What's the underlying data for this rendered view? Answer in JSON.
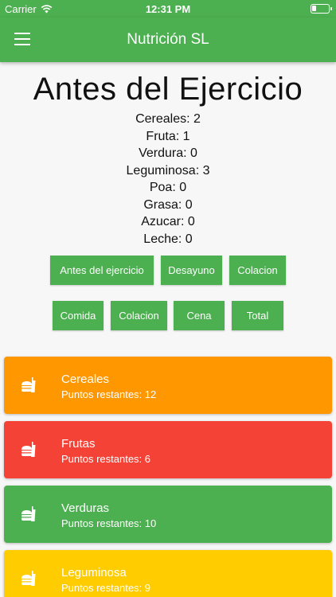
{
  "status_bar": {
    "carrier": "Carrier",
    "time": "12:31 PM"
  },
  "app_bar": {
    "title": "Nutrición SL"
  },
  "summary": {
    "title": "Antes del Ejercicio",
    "items": [
      "Cereales: 2",
      "Fruta: 1",
      "Verdura: 0",
      "Leguminosa: 3",
      "Poa: 0",
      "Grasa: 0",
      "Azucar: 0",
      "Leche: 0"
    ]
  },
  "meal_buttons": [
    "Antes del ejercicio",
    "Desayuno",
    "Colacion",
    "Comida",
    "Colacion",
    "Cena",
    "Total"
  ],
  "categories": [
    {
      "name": "Cereales",
      "points": "Puntos restantes: 12",
      "color": "#ff9800",
      "icon": "food-icon"
    },
    {
      "name": "Frutas",
      "points": "Puntos restantes: 6",
      "color": "#f44336",
      "icon": "food-icon"
    },
    {
      "name": "Verduras",
      "points": "Puntos restantes: 10",
      "color": "#4caf50",
      "icon": "food-icon"
    },
    {
      "name": "Leguminosa",
      "points": "Puntos restantes: 9",
      "color": "#ffcc00",
      "icon": "food-icon"
    }
  ]
}
